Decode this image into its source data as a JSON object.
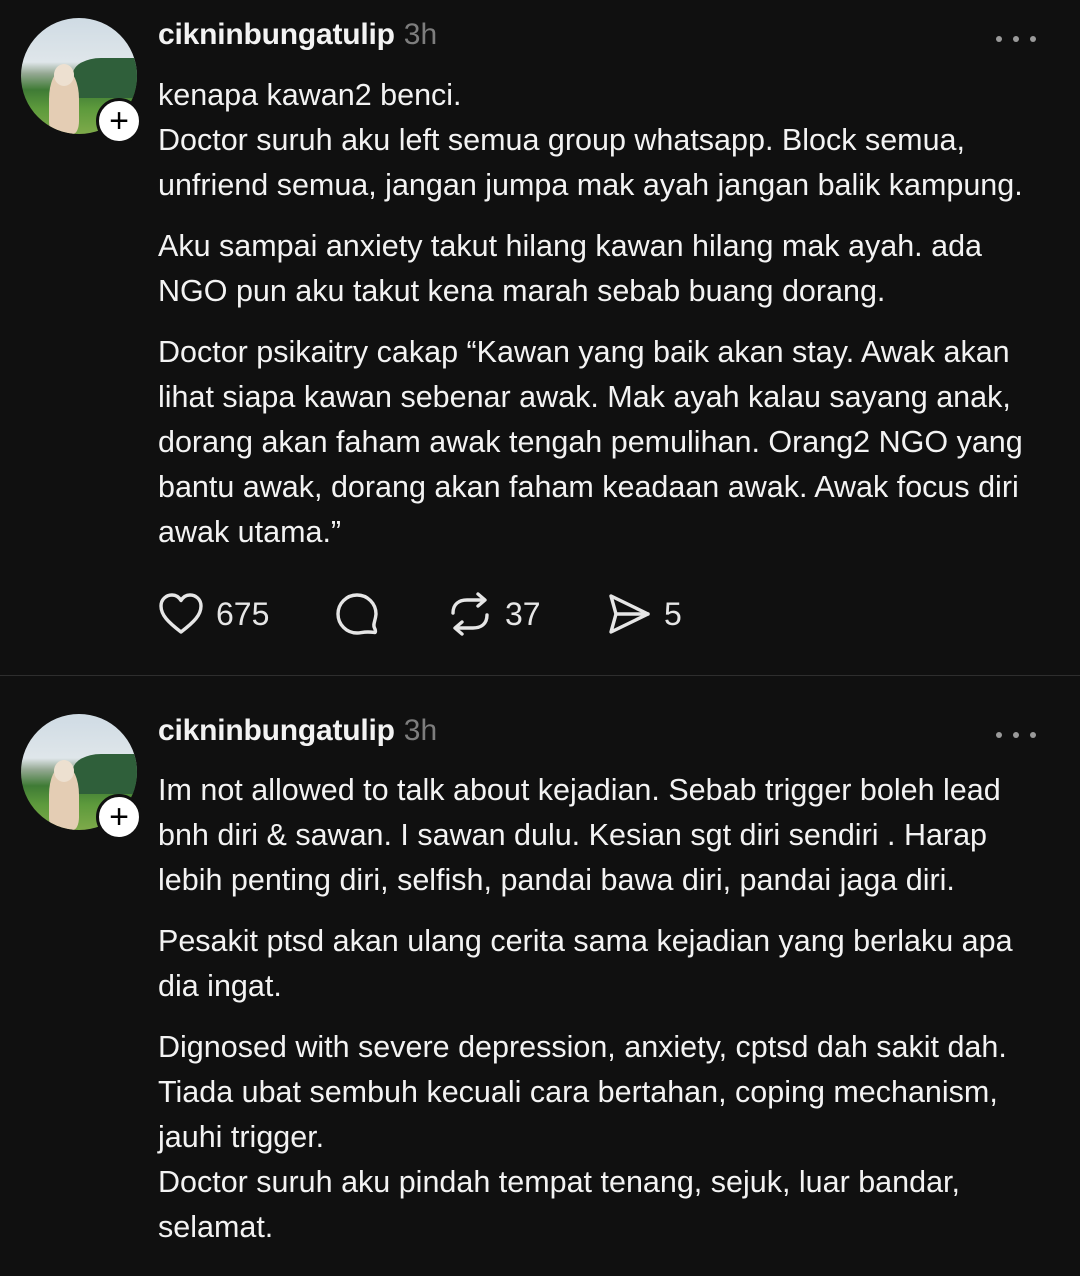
{
  "posts": [
    {
      "username": "cikninbungatulip",
      "time": "3h",
      "paragraphs": [
        "kenapa kawan2 benci.\nDoctor suruh aku left semua group whatsapp. Block semua, unfriend semua, jangan jumpa mak ayah jangan balik kampung.",
        "Aku sampai anxiety takut hilang kawan hilang mak ayah. ada NGO pun aku takut kena marah sebab buang dorang.",
        "Doctor psikaitry cakap “Kawan yang baik akan stay. Awak akan lihat siapa kawan sebenar awak. Mak ayah kalau sayang anak, dorang akan faham awak tengah pemulihan. Orang2 NGO yang bantu awak, dorang akan faham keadaan awak. Awak focus diri awak utama.”"
      ],
      "actions": {
        "likes": "675",
        "reposts": "37",
        "shares": "5"
      }
    },
    {
      "username": "cikninbungatulip",
      "time": "3h",
      "paragraphs": [
        "Im not allowed to talk about kejadian. Sebab trigger boleh lead bnh diri & sawan. I sawan dulu. Kesian sgt diri sendiri . Harap lebih penting diri, selfish, pandai bawa diri, pandai jaga diri.",
        "Pesakit ptsd akan ulang cerita sama kejadian yang berlaku apa dia ingat.",
        "Dignosed with severe depression, anxiety, cptsd dah sakit dah. Tiada ubat sembuh kecuali cara bertahan, coping mechanism, jauhi trigger.\nDoctor suruh aku pindah tempat tenang, sejuk, luar bandar, selamat."
      ]
    }
  ],
  "icons": {
    "like": "heart-icon",
    "reply": "speech-bubble-icon",
    "repost": "repost-arrows-icon",
    "share": "paper-plane-icon",
    "more": "ellipsis-icon",
    "follow": "plus-icon"
  },
  "colors": {
    "background": "#101010",
    "text": "#f3f3f3",
    "muted": "#7d7d7d",
    "divider": "#2e2e2e"
  }
}
